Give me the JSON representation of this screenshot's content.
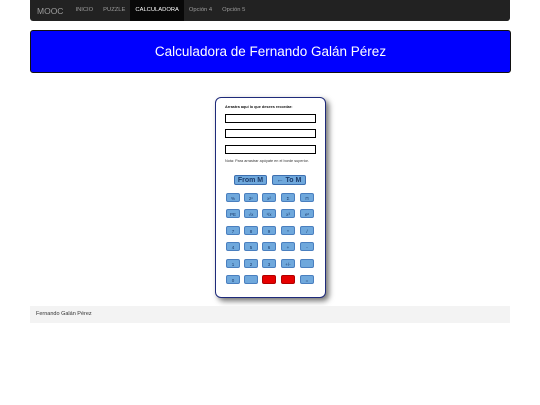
{
  "navbar": {
    "brand": "MOOC",
    "items": [
      "INICIO",
      "PUZZLE",
      "CALCULADORA",
      "Opción 4",
      "Opción 5"
    ],
    "active_index": 2
  },
  "banner": {
    "title": "Calculadora de Fernando Galán Pérez"
  },
  "calculator": {
    "drag_label": "Arrastra aquí lo que desees recordar:",
    "fields": [
      "",
      "",
      ""
    ],
    "note": "Nota: Para arrastrar apóyate en el borde superior.",
    "memory_buttons": [
      "From M",
      "← To M"
    ],
    "key_rows": [
      [
        "%",
        "2ⁿ",
        "x²",
        "Σ",
        "Π"
      ],
      [
        "PE",
        "√x",
        "¹/x",
        "x³",
        "eˣ"
      ],
      [
        "7",
        "8",
        "9",
        "*",
        "/"
      ],
      [
        "4",
        "5",
        "6",
        "+",
        "-"
      ],
      [
        "1",
        "2",
        "3",
        "+/-",
        ""
      ],
      [
        "0",
        "",
        "C",
        "CE",
        "="
      ]
    ]
  },
  "footer": {
    "text": "Fernando Galán Pérez"
  },
  "colors": {
    "banner": "#0000ff",
    "key": "#6fa8dc",
    "key_danger": "#e60000",
    "navbar": "#222222"
  }
}
